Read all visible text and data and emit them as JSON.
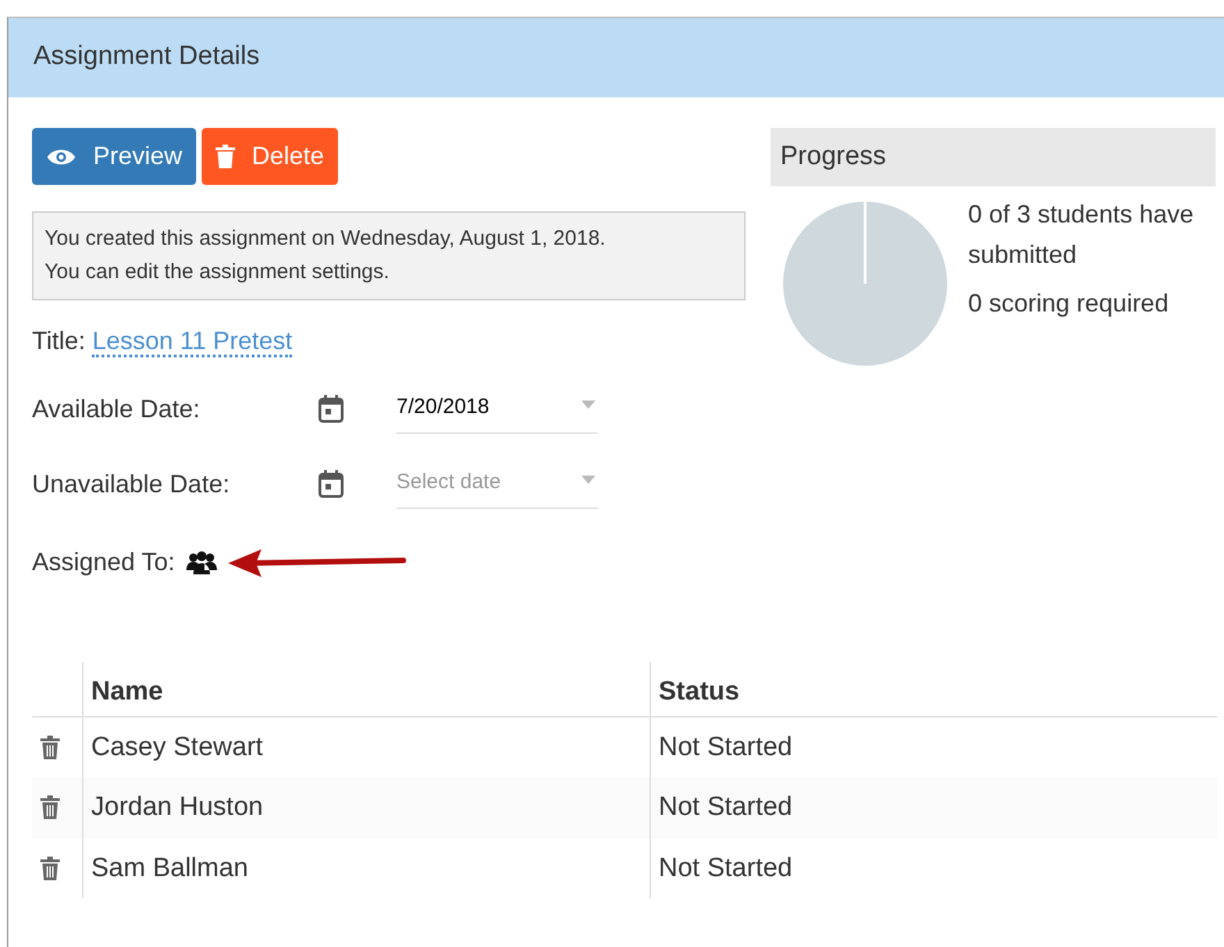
{
  "panel": {
    "title": "Assignment Details"
  },
  "buttons": [
    {
      "kind": "preview",
      "label": "Preview"
    },
    {
      "kind": "delete",
      "label": "Delete"
    }
  ],
  "info": [
    "You created this assignment on Wednesday, August 1, 2018.",
    "You can edit the assignment settings."
  ],
  "title_field": {
    "label": "Title:",
    "value": "Lesson 11 Pretest"
  },
  "dates": [
    {
      "label": "Available Date:",
      "value": "7/20/2018"
    },
    {
      "label": "Unavailable Date:",
      "placeholder": "Select date"
    }
  ],
  "assigned_to": {
    "label": "Assigned To:"
  },
  "progress": {
    "title": "Progress",
    "lines": [
      "0 of 3 students have submitted",
      "0 scoring required"
    ]
  },
  "table": {
    "columns": [
      "Name",
      "Status"
    ],
    "rows": [
      {
        "name": "Casey Stewart",
        "status": "Not Started"
      },
      {
        "name": "Jordan Huston",
        "status": "Not Started"
      },
      {
        "name": "Sam Ballman",
        "status": "Not Started"
      }
    ]
  }
}
